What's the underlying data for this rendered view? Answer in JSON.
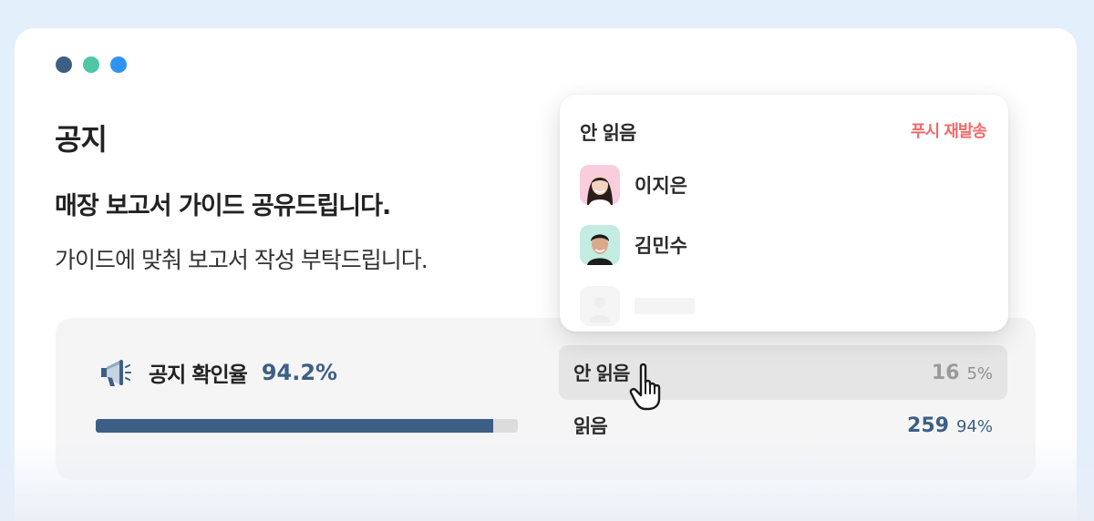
{
  "window": {
    "dots": [
      {
        "name": "dot-navy",
        "color": "#3d5f85"
      },
      {
        "name": "dot-teal",
        "color": "#4fc7a6"
      },
      {
        "name": "dot-blue",
        "color": "#2e94f4"
      }
    ]
  },
  "notice": {
    "title": "공지",
    "subject": "매장 보고서 가이드 공유드립니다.",
    "body": "가이드에 맞춰 보고서 작성 부탁드립니다."
  },
  "stats": {
    "icon": "megaphone-icon",
    "rate_label": "공지 확인율",
    "rate_value": "94.2%",
    "progress": 0.942,
    "unread": {
      "label": "안 읽음",
      "count": "16",
      "percent": "5%"
    },
    "read": {
      "label": "읽음",
      "count": "259",
      "percent": "94%"
    }
  },
  "unread_popup": {
    "title": "안 읽음",
    "resend_label": "푸시 재발송",
    "people": [
      {
        "name": "이지은",
        "avatar_bg": "#f9cddd"
      },
      {
        "name": "김민수",
        "avatar_bg": "#c3ece2"
      }
    ]
  },
  "colors": {
    "accent": "#3d5f85",
    "danger": "#f26a6a",
    "page_bg": "#e4effc"
  }
}
